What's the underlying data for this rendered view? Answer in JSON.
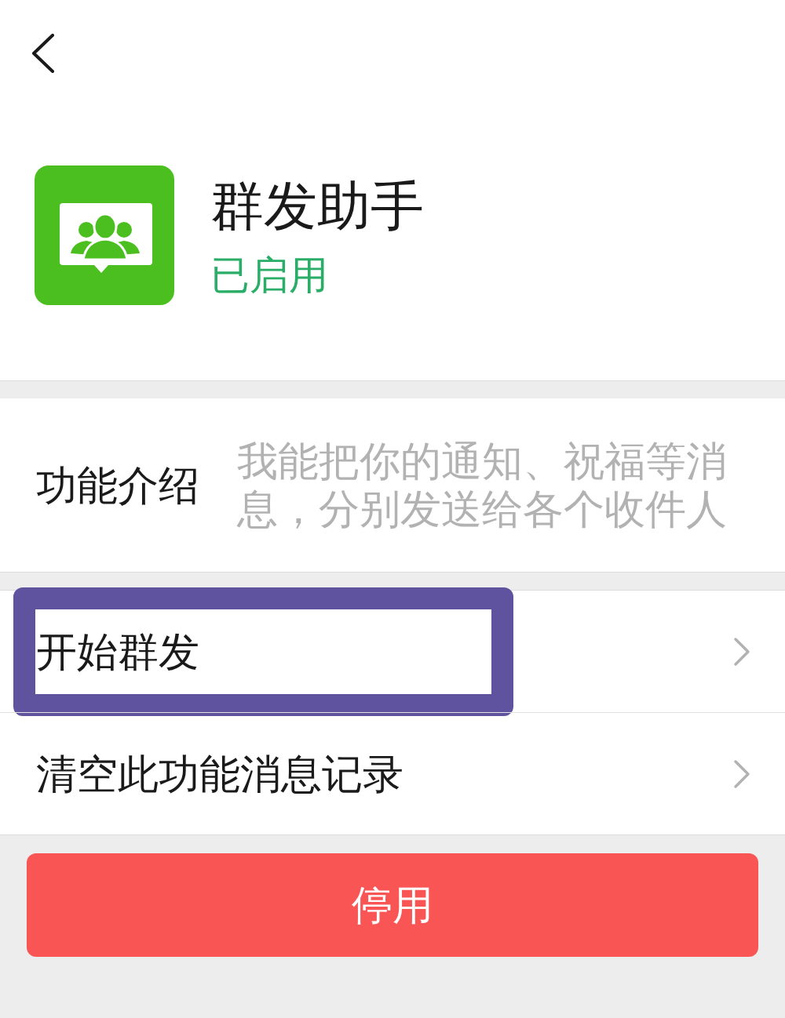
{
  "header": {
    "title": "群发助手",
    "status": "已启用",
    "enabled": true
  },
  "intro": {
    "label": "功能介绍",
    "text": "我能把你的通知、祝福等消息，分别发送给各个收件人"
  },
  "menu": [
    {
      "label": "开始群发",
      "highlighted": true
    },
    {
      "label": "清空此功能消息记录",
      "highlighted": false
    }
  ],
  "button": {
    "label": "停用",
    "kind": "danger"
  }
}
